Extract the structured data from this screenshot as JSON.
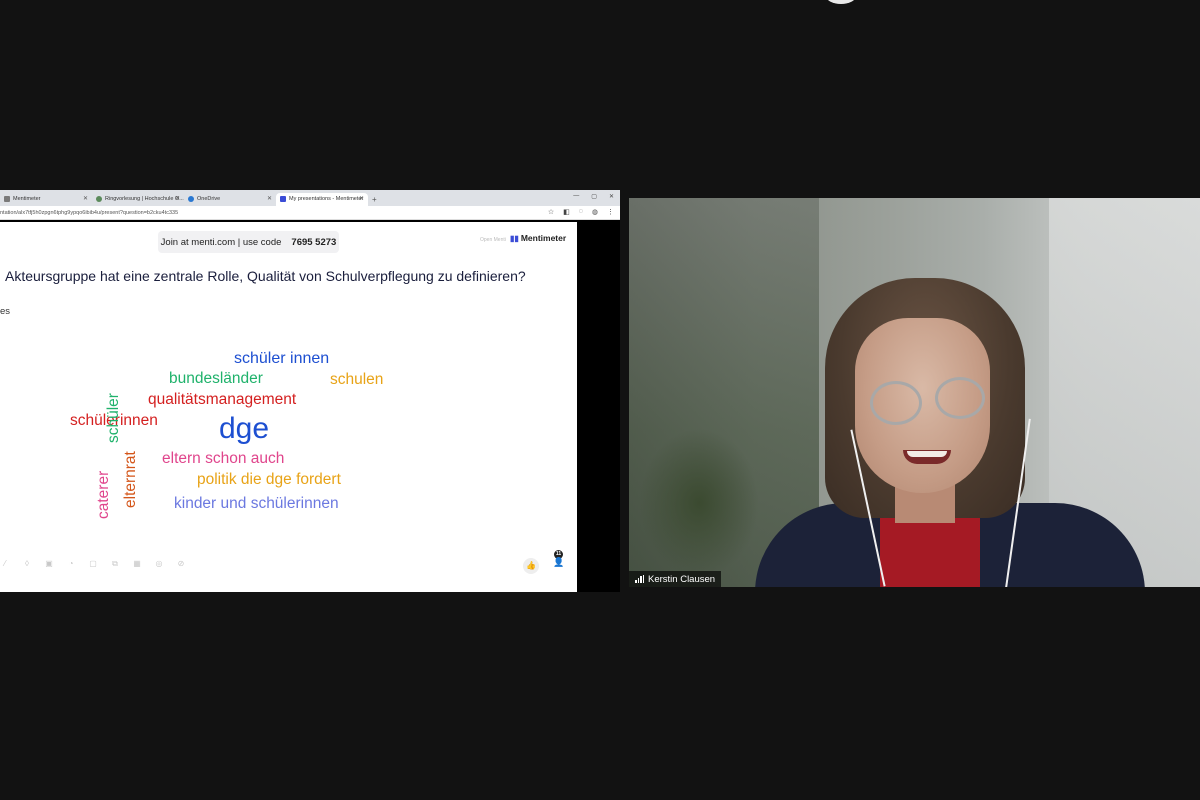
{
  "browser": {
    "tabs": [
      {
        "label": "Mentimeter",
        "active": false
      },
      {
        "label": "Ringvorlesung | Hochschule O...",
        "active": false
      },
      {
        "label": "OneDrive",
        "active": false
      },
      {
        "label": "My presentations - Mentimeter",
        "active": true
      }
    ],
    "new_tab": "+",
    "url": "ntation/alx7tfj5h0zpgn6tphg9ypqo6ibib4u/present?question=b2cku4tc335"
  },
  "slide": {
    "join_prefix": "Join at menti.com | use code",
    "join_code": "7695 5273",
    "open_menti": "Open Menti",
    "logo": "Mentimeter",
    "question": "Akteursgruppe hat eine zentrale Rolle, Qualität von Schulverpflegung zu definieren?",
    "responses_label": "es",
    "audience_count": "11",
    "words": [
      {
        "text": "schüler innen",
        "color": "#1d4fd1"
      },
      {
        "text": "bundesländer",
        "color": "#1fb26b"
      },
      {
        "text": "schulen",
        "color": "#e8a317"
      },
      {
        "text": "qualitätsmanagement",
        "color": "#d42020"
      },
      {
        "text": "schülerinnen",
        "color": "#d42020"
      },
      {
        "text": "dge",
        "color": "#1d4fd1"
      },
      {
        "text": "eltern schon auch",
        "color": "#e0458c"
      },
      {
        "text": "politik die dge fordert",
        "color": "#e8a317"
      },
      {
        "text": "kinder und schülerinnen",
        "color": "#6b78e0"
      },
      {
        "text": "schüler",
        "color": "#1fb26b"
      },
      {
        "text": "elternrat",
        "color": "#d4561a"
      },
      {
        "text": "caterer",
        "color": "#e0458c"
      }
    ]
  },
  "participant": {
    "name": "Kerstin Clausen"
  }
}
